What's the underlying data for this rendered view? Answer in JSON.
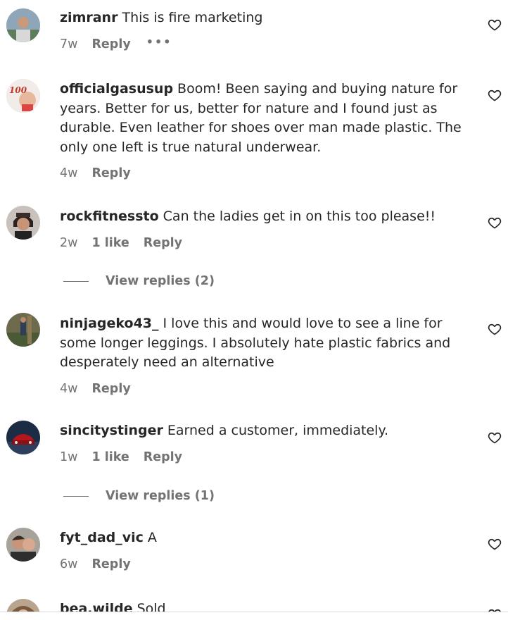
{
  "comments": [
    {
      "username": "zimranr",
      "text": "This is fire marketing",
      "time": "7w",
      "likes": "",
      "reply_label": "Reply",
      "more_label": "•••"
    },
    {
      "username": "officialgasusup",
      "text": "Boom! Been saying and buying nature for years. Better for us, better for nature and I found just as durable. Even leather for shoes over man made plastic. The only one left is true natural underwear.",
      "time": "4w",
      "likes": "",
      "reply_label": "Reply"
    },
    {
      "username": "rockfitnessto",
      "text": "Can the ladies get in on this too please!!",
      "time": "2w",
      "likes": "1 like",
      "reply_label": "Reply",
      "view_replies": "View replies (2)"
    },
    {
      "username": "ninjageko43_",
      "text": "I love this and would love to see a line for some longer leggings. I absolutely hate plastic fabrics and desperately need an alternative",
      "time": "4w",
      "likes": "",
      "reply_label": "Reply"
    },
    {
      "username": "sincitystinger",
      "text": "Earned a customer, immediately.",
      "time": "1w",
      "likes": "1 like",
      "reply_label": "Reply",
      "view_replies": "View replies (1)"
    },
    {
      "username": "fyt_dad_vic",
      "text": "A",
      "time": "6w",
      "likes": "",
      "reply_label": "Reply"
    },
    {
      "username": "bea.wilde",
      "text": "Sold",
      "time": "",
      "likes": "",
      "reply_label": ""
    }
  ],
  "icons": {
    "like": "heart-outline-icon",
    "more": "more-options-icon"
  },
  "colors": {
    "text": "#262626",
    "secondary": "#737373",
    "background": "#ffffff"
  }
}
